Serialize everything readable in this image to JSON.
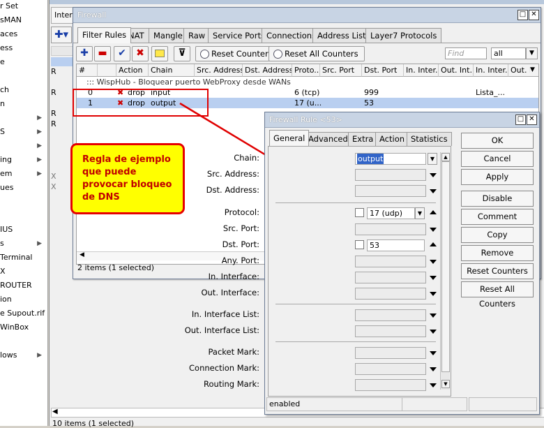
{
  "sidebar": {
    "items": [
      {
        "label": "r Set",
        "arrow": false
      },
      {
        "label": "sMAN",
        "arrow": false
      },
      {
        "label": "aces",
        "arrow": false
      },
      {
        "label": "ess",
        "arrow": false
      },
      {
        "label": "e",
        "arrow": false
      },
      {
        "label": "",
        "arrow": false
      },
      {
        "label": "ch",
        "arrow": false
      },
      {
        "label": "n",
        "arrow": false
      },
      {
        "label": "",
        "arrow": true
      },
      {
        "label": "S",
        "arrow": true
      },
      {
        "label": "",
        "arrow": true
      },
      {
        "label": "ing",
        "arrow": true
      },
      {
        "label": "em",
        "arrow": true
      },
      {
        "label": "ues",
        "arrow": false
      },
      {
        "label": "",
        "arrow": false
      },
      {
        "label": "",
        "arrow": false
      },
      {
        "label": "IUS",
        "arrow": false
      },
      {
        "label": "s",
        "arrow": true
      },
      {
        "label": " Terminal",
        "arrow": false
      },
      {
        "label": "X",
        "arrow": false
      },
      {
        "label": "ROUTER",
        "arrow": false
      },
      {
        "label": "ion",
        "arrow": false
      },
      {
        "label": "e Supout.rif",
        "arrow": false
      },
      {
        "label": " WinBox",
        "arrow": false
      },
      {
        "label": "",
        "arrow": false
      },
      {
        "label": "lows",
        "arrow": true
      }
    ]
  },
  "background_window": {
    "title": "Interface List",
    "tab": "Interfa",
    "rows": [
      "R",
      "R",
      "R",
      "R",
      "X",
      "X"
    ],
    "footer": "10 items (1 selected)"
  },
  "firewall": {
    "title": "Firewall",
    "tabs": [
      "Filter Rules",
      "NAT",
      "Mangle",
      "Raw",
      "Service Ports",
      "Connections",
      "Address Lists",
      "Layer7 Protocols"
    ],
    "toolbar": {
      "reset_counters": "Reset Counters",
      "reset_all_counters": "Reset All Counters",
      "find_placeholder": "Find",
      "filter_value": "all"
    },
    "columns": [
      "#",
      "Action",
      "Chain",
      "Src. Address",
      "Dst. Address",
      "Proto...",
      "Src. Port",
      "Dst. Port",
      "In. Inter...",
      "Out. Int...",
      "In. Inter...",
      "Out. In"
    ],
    "comment_row": "::: WispHub - Bloquear puerto WebProxy desde WANs",
    "rows": [
      {
        "num": "0",
        "action": "drop",
        "chain": "input",
        "proto": "6 (tcp)",
        "dst_port": "999",
        "in_list": "Lista_...",
        "selected": false
      },
      {
        "num": "1",
        "action": "drop",
        "chain": "output",
        "proto": "17 (u...",
        "dst_port": "53",
        "in_list": "",
        "selected": true
      }
    ],
    "status": "2 items (1 selected)"
  },
  "annotation": {
    "text": "Regla de ejemplo que puede provocar bloqueo de DNS",
    "color": "#e60000",
    "fill": "#ffff00"
  },
  "rule_dialog": {
    "title": "Firewall Rule <53>",
    "tabs": [
      "General",
      "Advanced",
      "Extra",
      "Action",
      "Statistics"
    ],
    "fields": {
      "chain_label": "Chain:",
      "chain_value": "output",
      "src_address_label": "Src. Address:",
      "dst_address_label": "Dst. Address:",
      "protocol_label": "Protocol:",
      "protocol_value": "17 (udp)",
      "src_port_label": "Src. Port:",
      "dst_port_label": "Dst. Port:",
      "dst_port_value": "53",
      "any_port_label": "Any. Port:",
      "in_interface_label": "In. Interface:",
      "out_interface_label": "Out. Interface:",
      "in_interface_list_label": "In. Interface List:",
      "out_interface_list_label": "Out. Interface List:",
      "packet_mark_label": "Packet Mark:",
      "connection_mark_label": "Connection Mark:",
      "routing_mark_label": "Routing Mark:"
    },
    "buttons": [
      "OK",
      "Cancel",
      "Apply",
      "Disable",
      "Comment",
      "Copy",
      "Remove",
      "Reset Counters",
      "Reset All Counters"
    ],
    "status": "enabled"
  }
}
